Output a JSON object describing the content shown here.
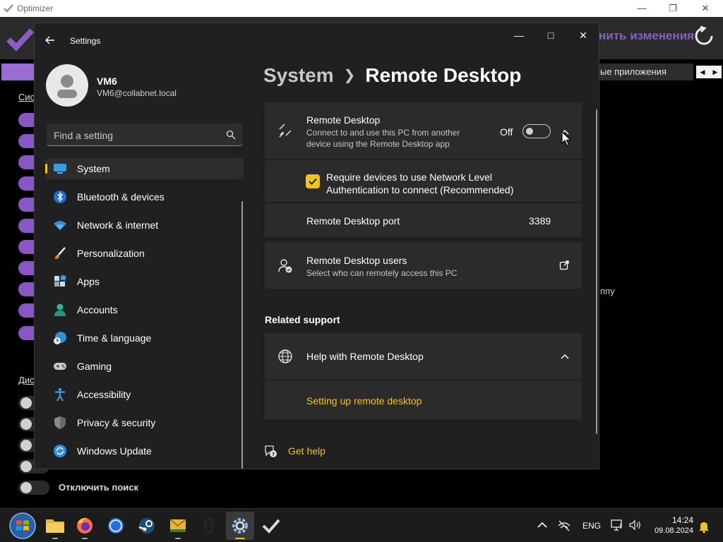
{
  "optimizer": {
    "title": "Optimizer",
    "apply_label": "нить изменения",
    "tab_text": "ые приложения",
    "section_links": [
      "Сис",
      "Дис"
    ],
    "side_text": "ппу",
    "search_toggle_label": "Отключить поиск",
    "colors": {
      "accent": "#8b5cc7",
      "toggle": "#8a55c4"
    }
  },
  "settings": {
    "title": "Settings",
    "user": {
      "name": "VM6",
      "email": "VM6@collabnet.local"
    },
    "search_placeholder": "Find a setting",
    "nav": [
      {
        "label": "System",
        "icon": "monitor-icon",
        "active": true
      },
      {
        "label": "Bluetooth & devices",
        "icon": "bluetooth-icon"
      },
      {
        "label": "Network & internet",
        "icon": "wifi-icon"
      },
      {
        "label": "Personalization",
        "icon": "brush-icon"
      },
      {
        "label": "Apps",
        "icon": "apps-icon"
      },
      {
        "label": "Accounts",
        "icon": "person-icon"
      },
      {
        "label": "Time & language",
        "icon": "globe-clock-icon"
      },
      {
        "label": "Gaming",
        "icon": "gamepad-icon"
      },
      {
        "label": "Accessibility",
        "icon": "accessibility-icon"
      },
      {
        "label": "Privacy & security",
        "icon": "shield-icon"
      },
      {
        "label": "Windows Update",
        "icon": "update-icon"
      }
    ],
    "breadcrumb": {
      "parent": "System",
      "current": "Remote Desktop"
    },
    "remote_desktop": {
      "title": "Remote Desktop",
      "description": "Connect to and use this PC from another device using the Remote Desktop app",
      "state_label": "Off",
      "enabled": false
    },
    "nla": {
      "label": "Require devices to use Network Level Authentication to connect (Recommended)",
      "checked": true
    },
    "port": {
      "label": "Remote Desktop port",
      "value": "3389"
    },
    "users": {
      "title": "Remote Desktop users",
      "subtitle": "Select who can remotely access this PC"
    },
    "related_support": "Related support",
    "help": {
      "title": "Help with Remote Desktop",
      "link": "Setting up remote desktop"
    },
    "get_help": "Get help",
    "colors": {
      "accent": "#f0c419",
      "background": "#202020",
      "card": "#2b2b2b"
    }
  },
  "taskbar": {
    "apps": [
      "explorer-icon",
      "firefox-icon",
      "chrome-icon",
      "steam-icon",
      "mail-icon",
      "mouse-icon",
      "settings-gear-icon",
      "optimizer-check-icon"
    ],
    "language": "ENG",
    "time": "14:24",
    "date": "09.08.2024"
  }
}
